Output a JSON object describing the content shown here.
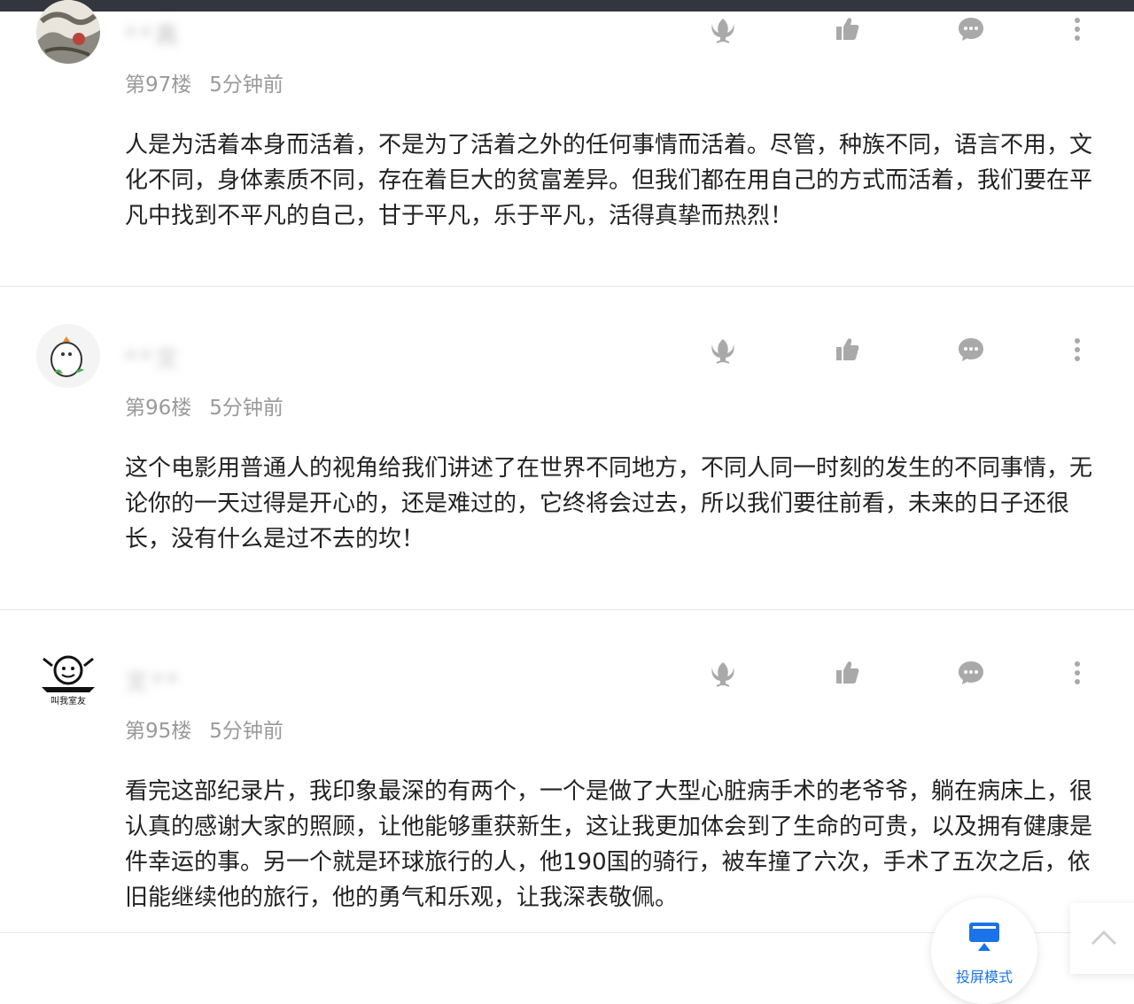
{
  "comments": [
    {
      "username": "**真",
      "floor": "第97楼",
      "time": "5分钟前",
      "text": "人是为活着本身而活着，不是为了活着之外的任何事情而活着。尽管，种族不同，语言不用，文化不同，身体素质不同，存在着巨大的贫富差异。但我们都在用自己的方式而活着，我们要在平凡中找到不平凡的自己，甘于平凡，乐于平凡，活得真挚而热烈！"
    },
    {
      "username": "**文",
      "floor": "第96楼",
      "time": "5分钟前",
      "text": "这个电影用普通人的视角给我们讲述了在世界不同地方，不同人同一时刻的发生的不同事情，无论你的一天过得是开心的，还是难过的，它终将会过去，所以我们要往前看，未来的日子还很长，没有什么是过不去的坎！"
    },
    {
      "username": "文**",
      "floor": "第95楼",
      "time": "5分钟前",
      "text": "看完这部纪录片，我印象最深的有两个，一个是做了大型心脏病手术的老爷爷，躺在病床上，很认真的感谢大家的照顾，让他能够重获新生，这让我更加体会到了生命的可贵，以及拥有健康是件幸运的事。另一个就是环球旅行的人，他190国的骑行，被车撞了六次，手术了五次之后，依旧能继续他的旅行，他的勇气和乐观，让我深表敬佩。",
      "avatar_text": "叫我室友"
    }
  ],
  "floating": {
    "cast_label": "投屏模式"
  },
  "colors": {
    "accent": "#1a73e8",
    "icon": "#a9a9a9",
    "topbar": "#33363f"
  }
}
